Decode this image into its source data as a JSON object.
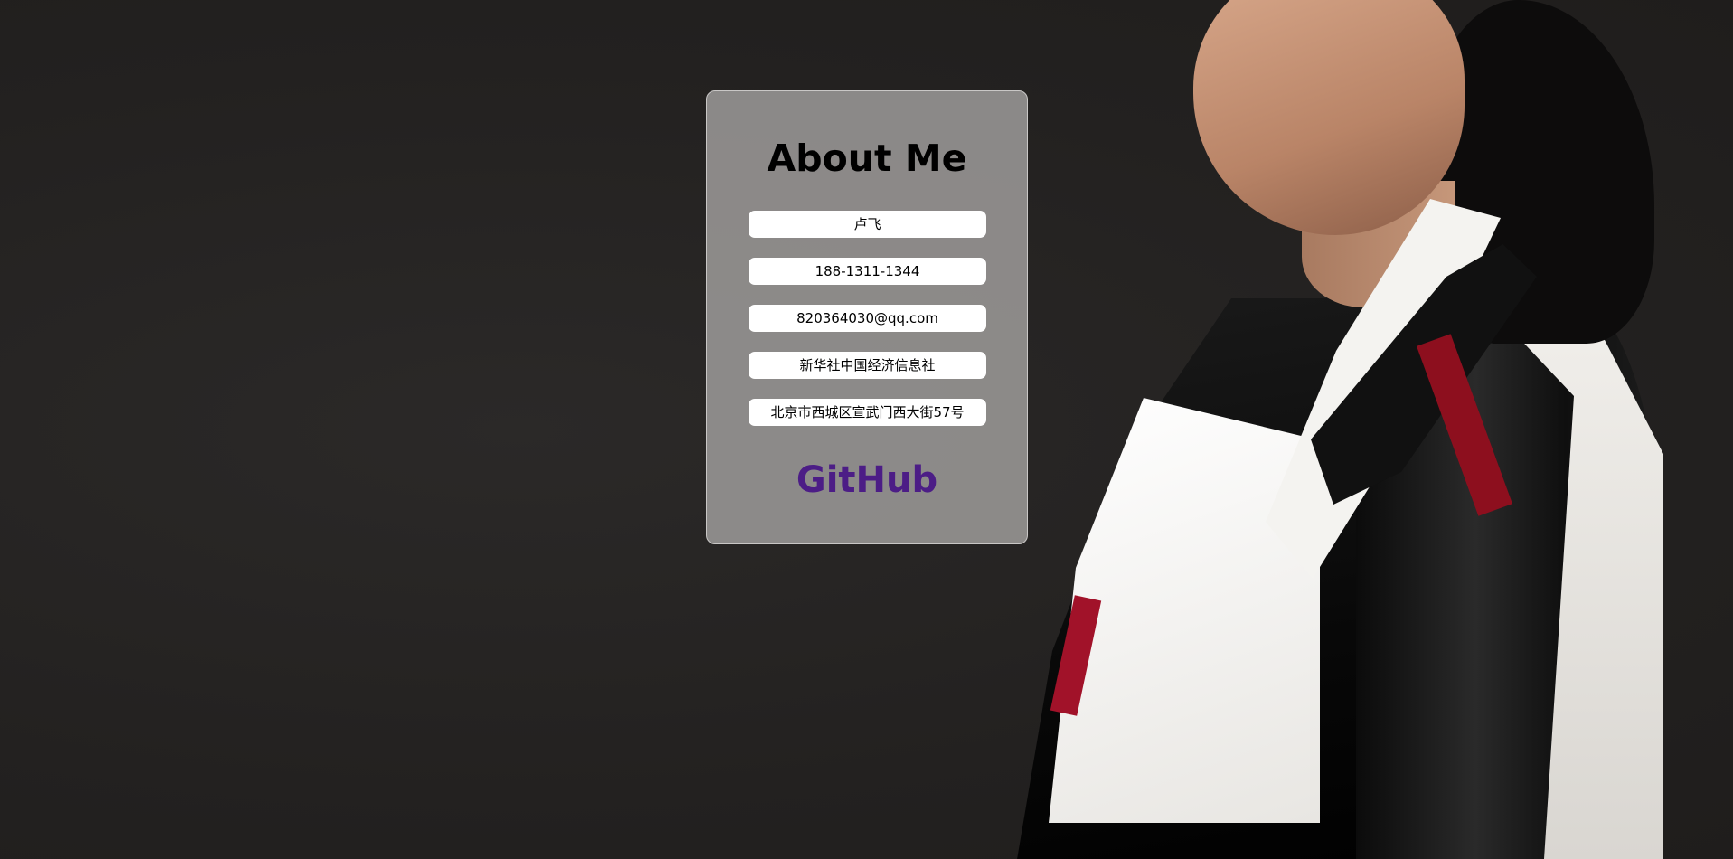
{
  "card": {
    "title": "About Me",
    "fields": [
      {
        "value": "卢飞"
      },
      {
        "value": "188-1311-1344"
      },
      {
        "value": "820364030@qq.com"
      },
      {
        "value": "新华社中国经济信息社"
      },
      {
        "value": "北京市西城区宣武门西大街57号"
      }
    ],
    "link_label": "GitHub"
  },
  "colors": {
    "background": "#252322",
    "card_background": "#918f8e",
    "link": "#4c1d86",
    "field_background": "#ffffff"
  },
  "images": {
    "background_photo": "woman-in-hanbok-photo"
  }
}
